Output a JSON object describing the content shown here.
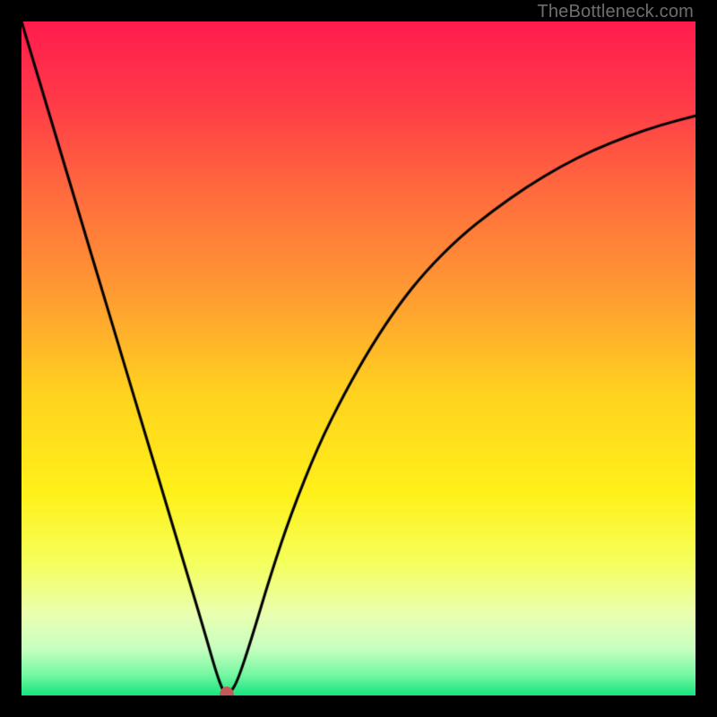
{
  "watermark": "TheBottleneck.com",
  "chart_data": {
    "type": "line",
    "title": "",
    "xlabel": "",
    "ylabel": "",
    "xlim": [
      0,
      100
    ],
    "ylim": [
      0,
      100
    ],
    "x": [
      0,
      3,
      6,
      9,
      12,
      15,
      18,
      21,
      24,
      27,
      29,
      30,
      30.5,
      31,
      32,
      34,
      37,
      40,
      44,
      48,
      52,
      56,
      60,
      65,
      70,
      75,
      80,
      85,
      90,
      95,
      100
    ],
    "values": [
      100,
      90,
      80,
      70,
      60,
      50,
      40,
      30,
      20,
      10,
      3,
      0.5,
      0,
      0.5,
      2,
      8,
      18,
      27,
      37,
      45,
      52,
      58,
      63,
      68,
      72,
      75.5,
      78.5,
      81,
      83,
      84.7,
      86
    ],
    "marker": {
      "x": 30.5,
      "y": 0
    },
    "gradient_stops": [
      {
        "pos": 0.0,
        "color": "#ff1c4d"
      },
      {
        "pos": 0.12,
        "color": "#ff3b48"
      },
      {
        "pos": 0.25,
        "color": "#ff6a3e"
      },
      {
        "pos": 0.4,
        "color": "#ff9a33"
      },
      {
        "pos": 0.55,
        "color": "#ffd21f"
      },
      {
        "pos": 0.7,
        "color": "#fff11a"
      },
      {
        "pos": 0.8,
        "color": "#f6ff5a"
      },
      {
        "pos": 0.88,
        "color": "#eaffb2"
      },
      {
        "pos": 0.93,
        "color": "#c8ffc0"
      },
      {
        "pos": 0.97,
        "color": "#74f7a2"
      },
      {
        "pos": 1.0,
        "color": "#16e47e"
      }
    ],
    "curve_color": "#000000",
    "marker_color": "#c45a57"
  }
}
